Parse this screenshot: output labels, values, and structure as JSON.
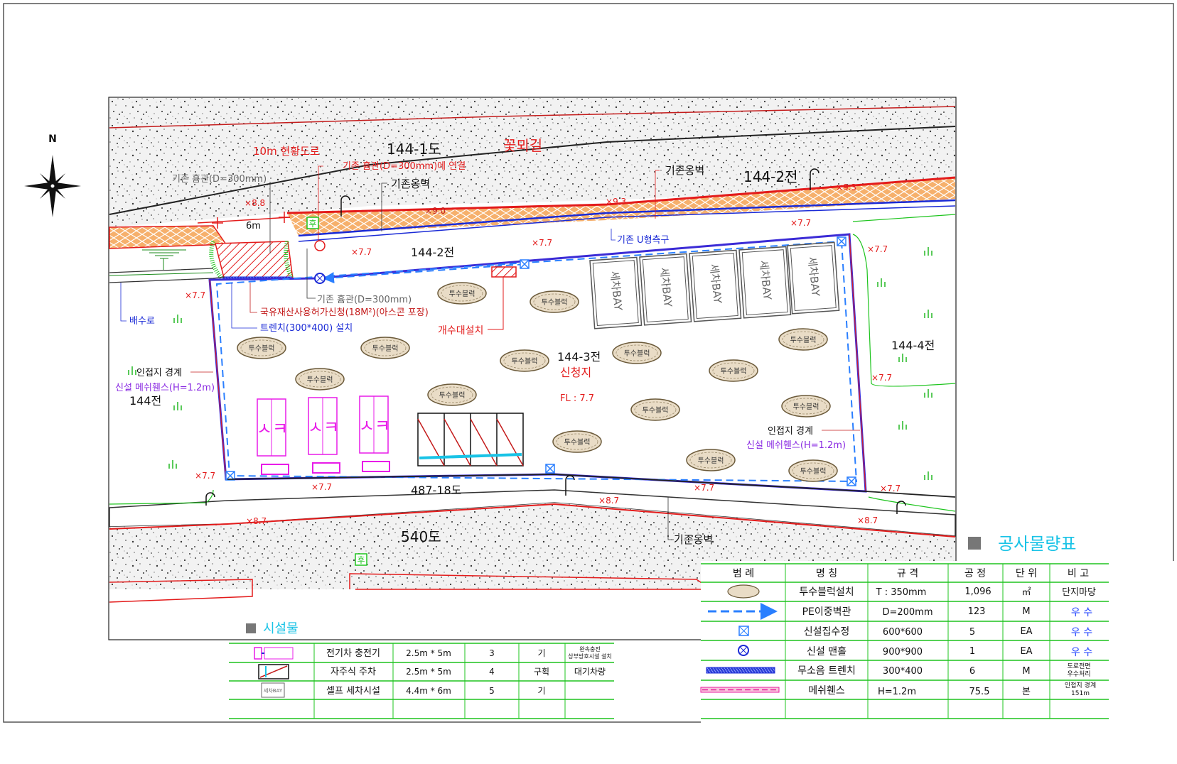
{
  "labels": {
    "road_10m": "10m 현황도로",
    "lot_144_1": "144-1도",
    "flower_road": "꽃뫼길",
    "connect_pipe": "기존 흄관(D=300mm)에 연결",
    "exist_pipe_top": "기존 흄관(D=300mm)",
    "retaining_wall_1": "기존옹벽",
    "retaining_wall_2": "기존옹벽",
    "retaining_wall_3": "기존옹벽",
    "lot_144_2_top": "144-2전",
    "lot_144_2_mid": "144-2전",
    "u_ditch": "기존 U형측구",
    "width_6m": "6m",
    "exist_pipe_bottom": "기존 흄관(D=300mm)",
    "state_land": "국유재산사용허가신청(18M²)(아스콘 포장)",
    "trench": "트렌치(300*400) 설치",
    "drain": "배수로",
    "ditch_install": "개수대설치",
    "adj_boundary_left": "인접지 경계",
    "mesh_fence_left": "신설 메쉬휀스(H=1.2m)",
    "lot_144": "144전",
    "lot_144_3": "144-3전",
    "applicant_site": "신청지",
    "fl": "FL : 7.7",
    "lot_144_4": "144-4전",
    "adj_boundary_right": "인접지 경계",
    "mesh_fence_right": "신설 메쉬휀스(H=1.2m)",
    "lot_487_18": "487-18도",
    "lot_540": "540도",
    "wash_bay": "세차BAY",
    "permeable_block": "투수블럭",
    "charger_glyph": "ㅅㅋ",
    "north": "N",
    "hu_mark": "후",
    "hu_mark2": "후"
  },
  "spot_levels": {
    "e88": "8.8",
    "e90": "9.0",
    "e93a": "9.3",
    "e93b": "9.3",
    "e77a": "7.7",
    "e77b": "7.7",
    "e77c": "7.7",
    "e77d": "7.7",
    "e77e": "7.7",
    "e77f": "7.7",
    "e77g": "7.7",
    "e77h": "7.7",
    "e77i": "7.7",
    "e77j": "7.7",
    "e87a": "8.7",
    "e87b": "8.7",
    "e87c": "8.7"
  },
  "facilities": {
    "title": "시설물",
    "rows": [
      {
        "name": "전기차 충전기",
        "spec": "2.5m * 5m",
        "qty": "3",
        "unit": "기",
        "note": "완속충전\n상부방호시설 설치"
      },
      {
        "name": "자주식 주차",
        "spec": "2.5m * 5m",
        "qty": "4",
        "unit": "구획",
        "note": "대기차량"
      },
      {
        "name": "셀프 세차시설",
        "spec": "4.4m * 6m",
        "qty": "5",
        "unit": "기",
        "note": ""
      }
    ],
    "legend_bay_text": "세차BAY"
  },
  "quantity": {
    "title": "공사물량표",
    "headers": {
      "legend": "범 례",
      "name": "명 칭",
      "spec": "규 격",
      "qty": "공 정",
      "unit": "단 위",
      "note": "비 고"
    },
    "rows": [
      {
        "name": "투수블럭설치",
        "spec": "T : 350mm",
        "qty": "1,096",
        "unit": "㎡",
        "note": "단지마당"
      },
      {
        "name": "PE이중벽관",
        "spec": "D=200mm",
        "qty": "123",
        "unit": "M",
        "note": "우 수"
      },
      {
        "name": "신설집수정",
        "spec": "600*600",
        "qty": "5",
        "unit": "EA",
        "note": "우 수"
      },
      {
        "name": "신설 맨홀",
        "spec": "900*900",
        "qty": "1",
        "unit": "EA",
        "note": "우 수"
      },
      {
        "name": "무소음 트렌치",
        "spec": "300*400",
        "qty": "6",
        "unit": "M",
        "note": "도로전면\n우수처리"
      },
      {
        "name": "메쉬휀스",
        "spec": "H=1.2m",
        "qty": "75.5",
        "unit": "본",
        "note": "인접지 경계\n151m"
      }
    ],
    "note_colors": {
      "rain": "#1a3cff",
      "default": "#000000"
    }
  },
  "colors": {
    "boundary": "#3b2bd6",
    "red": "#e31b1b",
    "blue_pipe": "#2a7fff",
    "magenta": "#e81ce8",
    "green": "#1ec41e",
    "orange_band": "#f3a35a",
    "purple_text": "#8a2be2",
    "cyan": "#19c3e6"
  }
}
